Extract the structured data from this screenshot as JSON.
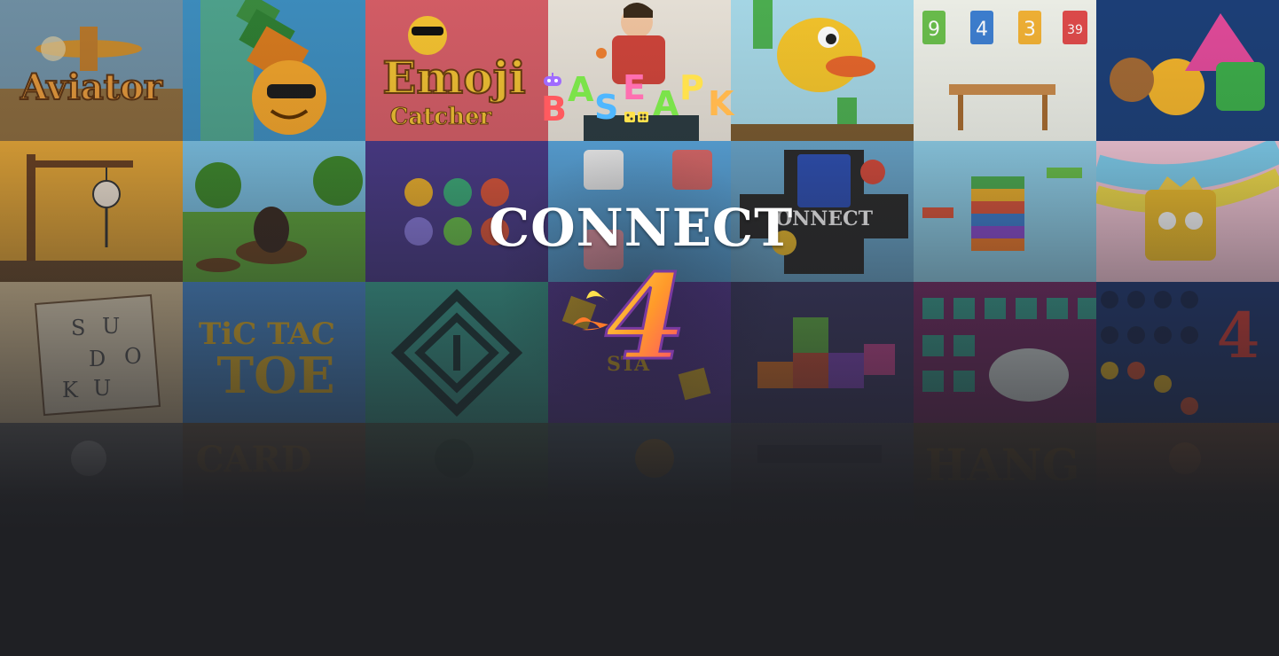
{
  "logo": {
    "letters": [
      "B",
      "A",
      "S",
      "E",
      "A",
      "P",
      "K"
    ],
    "colors": [
      "#ff5a5f",
      "#7be34a",
      "#4fb7ff",
      "#ff6fb0",
      "#ffe14d",
      "#a06bff",
      "#ffb74d"
    ]
  },
  "game": {
    "title_word": "CONNECT",
    "title_number": "4"
  },
  "tiles": [
    {
      "name": "aviator",
      "caption": "Aviator"
    },
    {
      "name": "2048-ball",
      "caption": ""
    },
    {
      "name": "emoji-catcher",
      "caption": "Emoji Catcher"
    },
    {
      "name": "ping-pong",
      "caption": ""
    },
    {
      "name": "flappy-bird",
      "caption": ""
    },
    {
      "name": "math-game",
      "caption": ""
    },
    {
      "name": "shapes",
      "caption": ""
    },
    {
      "name": "hangman",
      "caption": ""
    },
    {
      "name": "whack-a-mole",
      "caption": ""
    },
    {
      "name": "color-balls",
      "caption": ""
    },
    {
      "name": "memory",
      "caption": ""
    },
    {
      "name": "connect-4-tile",
      "caption": ""
    },
    {
      "name": "stack-blocks",
      "caption": ""
    },
    {
      "name": "cube-runner",
      "caption": ""
    },
    {
      "name": "sudoku",
      "caption": ""
    },
    {
      "name": "tic-tac-toe",
      "caption": ""
    },
    {
      "name": "maze",
      "caption": ""
    },
    {
      "name": "stack",
      "caption": ""
    },
    {
      "name": "blocks",
      "caption": ""
    },
    {
      "name": "typing-game",
      "caption": ""
    },
    {
      "name": "four-in-a-row",
      "caption": ""
    },
    {
      "name": "chicken",
      "caption": ""
    },
    {
      "name": "card",
      "caption": ""
    },
    {
      "name": "darts",
      "caption": ""
    },
    {
      "name": "basket",
      "caption": ""
    },
    {
      "name": "birds",
      "caption": ""
    },
    {
      "name": "hang",
      "caption": ""
    },
    {
      "name": "puzzle",
      "caption": ""
    }
  ]
}
